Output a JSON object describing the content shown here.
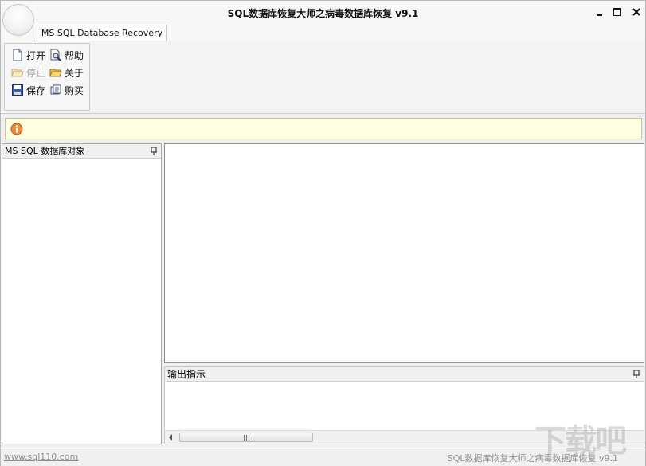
{
  "window": {
    "title": "SQL数据库恢复大师之病毒数据库恢复 v9.1"
  },
  "ribbon": {
    "tab_label": "MS SQL Database Recovery",
    "buttons": {
      "open": "打开",
      "help": "帮助",
      "stop": "停止",
      "about": "关于",
      "save": "保存",
      "buy": "购买"
    }
  },
  "left_panel": {
    "title": "MS SQL 数据库对象"
  },
  "output_panel": {
    "title": "输出指示"
  },
  "statusbar": {
    "link": "www.sql110.com",
    "right_text": "SQL数据库恢复大师之病毒数据库恢复 v9.1"
  },
  "watermark": "下载吧",
  "colors": {
    "info_bg": "#ffffe1",
    "info_icon": "#e8772e"
  }
}
